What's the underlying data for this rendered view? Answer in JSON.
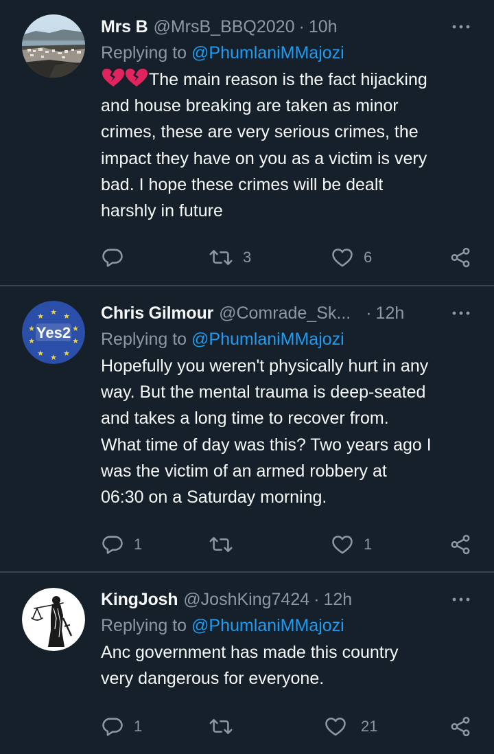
{
  "colors": {
    "background": "#15202b",
    "divider": "#38444d",
    "text_primary": "#f7f9f9",
    "text_secondary": "#8b98a5",
    "accent": "#1d9bf0",
    "heart_emoji": "#e0245e"
  },
  "icons": {
    "reply": "reply-icon",
    "retweet": "retweet-icon",
    "like": "heart-outline-icon",
    "share": "share-icon",
    "more": "more-dots-icon",
    "emoji": "broken-heart-emoji"
  },
  "tweets": [
    {
      "name": "Mrs B",
      "handle": "@MrsB_BBQ2020",
      "separator": "·",
      "time": "10h",
      "replying_prefix": "Replying to",
      "replying_to": "@PhumlaniMMajozi",
      "text": "The main reason is the fact hijacking\nand house  breaking are taken as minor\ncrimes, these are very serious crimes, the\nimpact they have on you as a victim is very\nbad. I hope these crimes will be dealt\nharshly in future",
      "emoji_prefix": "💔💔",
      "replies": "",
      "retweets": "3",
      "likes": "6"
    },
    {
      "name": "Chris Gilmour",
      "handle": "@Comrade_Sk...",
      "separator": "·",
      "time": "12h",
      "replying_prefix": "Replying to",
      "replying_to": "@PhumlaniMMajozi",
      "text": "Hopefully you weren't physically hurt in any\nway. But the mental trauma is deep-seated\nand takes a long time to recover from.\nWhat time of day was this? Two years ago I\nwas the victim of an armed robbery at\n06:30 on a Saturday morning.",
      "avatar_text": "Yes2",
      "replies": "1",
      "retweets": "",
      "likes": "1"
    },
    {
      "name": "KingJosh",
      "handle": "@JoshKing7424",
      "separator": "·",
      "time": "12h",
      "replying_prefix": "Replying to",
      "replying_to": "@PhumlaniMMajozi",
      "text": "Anc government has made this country\nvery dangerous for everyone.",
      "replies": "1",
      "retweets": "",
      "likes": "21"
    }
  ]
}
